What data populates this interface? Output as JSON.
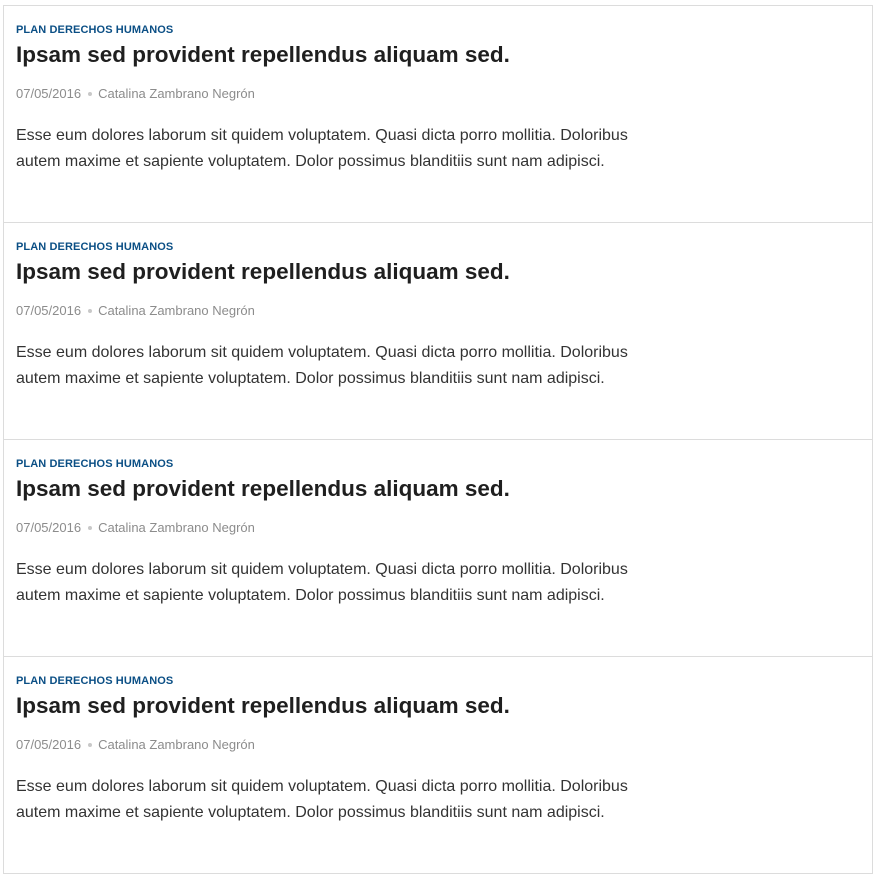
{
  "articles": [
    {
      "category": "PLAN DERECHOS HUMANOS",
      "title": "Ipsam sed provident repellendus aliquam sed.",
      "date": "07/05/2016",
      "author": "Catalina Zambrano Negrón",
      "excerpt": "Esse eum dolores laborum sit quidem voluptatem. Quasi dicta porro mollitia. Doloribus autem maxime et sapiente voluptatem. Dolor possimus blanditiis sunt nam adipisci."
    },
    {
      "category": "PLAN DERECHOS HUMANOS",
      "title": "Ipsam sed provident repellendus aliquam sed.",
      "date": "07/05/2016",
      "author": "Catalina Zambrano Negrón",
      "excerpt": "Esse eum dolores laborum sit quidem voluptatem. Quasi dicta porro mollitia. Doloribus autem maxime et sapiente voluptatem. Dolor possimus blanditiis sunt nam adipisci."
    },
    {
      "category": "PLAN DERECHOS HUMANOS",
      "title": "Ipsam sed provident repellendus aliquam sed.",
      "date": "07/05/2016",
      "author": "Catalina Zambrano Negrón",
      "excerpt": "Esse eum dolores laborum sit quidem voluptatem. Quasi dicta porro mollitia. Doloribus autem maxime et sapiente voluptatem. Dolor possimus blanditiis sunt nam adipisci."
    },
    {
      "category": "PLAN DERECHOS HUMANOS",
      "title": "Ipsam sed provident repellendus aliquam sed.",
      "date": "07/05/2016",
      "author": "Catalina Zambrano Negrón",
      "excerpt": "Esse eum dolores laborum sit quidem voluptatem. Quasi dicta porro mollitia. Doloribus autem maxime et sapiente voluptatem. Dolor possimus blanditiis sunt nam adipisci."
    }
  ],
  "colors": {
    "category": "#0b4f85",
    "title": "#1f1f1f",
    "meta": "#8c8c8c",
    "excerpt": "#333333",
    "border": "#dcdcdc"
  }
}
